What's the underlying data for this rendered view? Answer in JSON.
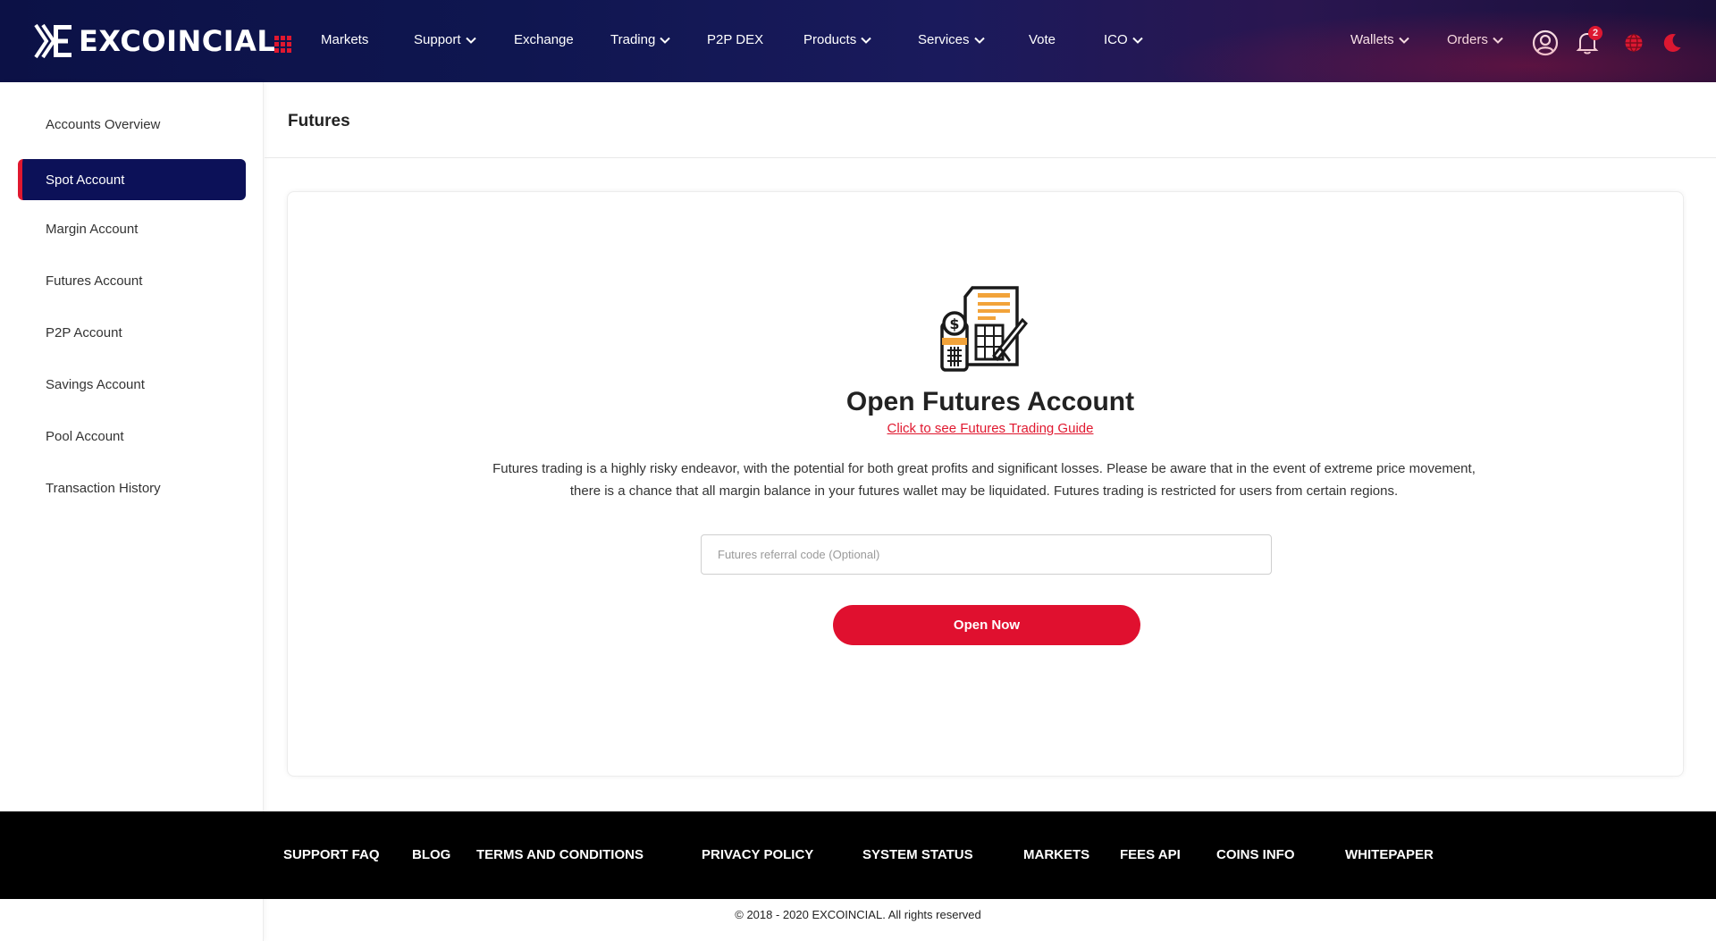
{
  "brand": {
    "name": "EXCOINCIAL",
    "accent_color": "#e0182f",
    "nav_bg": "#0c1146",
    "active_bg": "#0c1158"
  },
  "header": {
    "apps_icon": "grid-icon",
    "nav": [
      {
        "label": "Markets",
        "dropdown": false
      },
      {
        "label": "Support",
        "dropdown": true
      },
      {
        "label": "Exchange",
        "dropdown": false
      },
      {
        "label": "Trading",
        "dropdown": true
      },
      {
        "label": "P2P DEX",
        "dropdown": false
      },
      {
        "label": "Products",
        "dropdown": true
      },
      {
        "label": "Services",
        "dropdown": true
      },
      {
        "label": "Vote",
        "dropdown": false
      },
      {
        "label": "ICO",
        "dropdown": true
      }
    ],
    "right": [
      {
        "label": "Wallets",
        "dropdown": true
      },
      {
        "label": "Orders",
        "dropdown": true
      }
    ],
    "icons": {
      "user": "user-icon",
      "notifications": "bell-icon",
      "notifications_count": "2",
      "language": "globe-icon",
      "theme": "moon-icon"
    }
  },
  "sidebar": {
    "items": [
      {
        "label": "Accounts Overview",
        "active": false
      },
      {
        "label": "Spot Account",
        "active": true
      },
      {
        "label": "Margin Account",
        "active": false
      },
      {
        "label": "Futures Account",
        "active": false
      },
      {
        "label": "P2P Account",
        "active": false
      },
      {
        "label": "Savings Account",
        "active": false
      },
      {
        "label": "Pool Account",
        "active": false
      },
      {
        "label": "Transaction History",
        "active": false
      }
    ]
  },
  "main": {
    "page_title": "Futures",
    "card": {
      "icon": "futures-document-icon",
      "title": "Open Futures Account",
      "guide_link": "Click to see Futures Trading Guide",
      "description": "Futures trading is a highly risky endeavor, with the potential for both great profits and significant losses. Please be aware that in the event of extreme price movement, there is a chance that all margin balance in your futures wallet may be liquidated. Futures trading is restricted for users from certain regions.",
      "referral_value": "",
      "referral_placeholder": "Futures referral code (Optional)",
      "button_label": "Open Now"
    }
  },
  "footer": {
    "links": [
      "SUPPORT FAQ",
      "BLOG",
      "TERMS AND CONDITIONS",
      "PRIVACY POLICY",
      "SYSTEM STATUS",
      "MARKETS",
      "FEES API",
      "COINS INFO",
      "WHITEPAPER"
    ],
    "copyright": "© 2018 - 2020 EXCOINCIAL. All rights reserved"
  }
}
